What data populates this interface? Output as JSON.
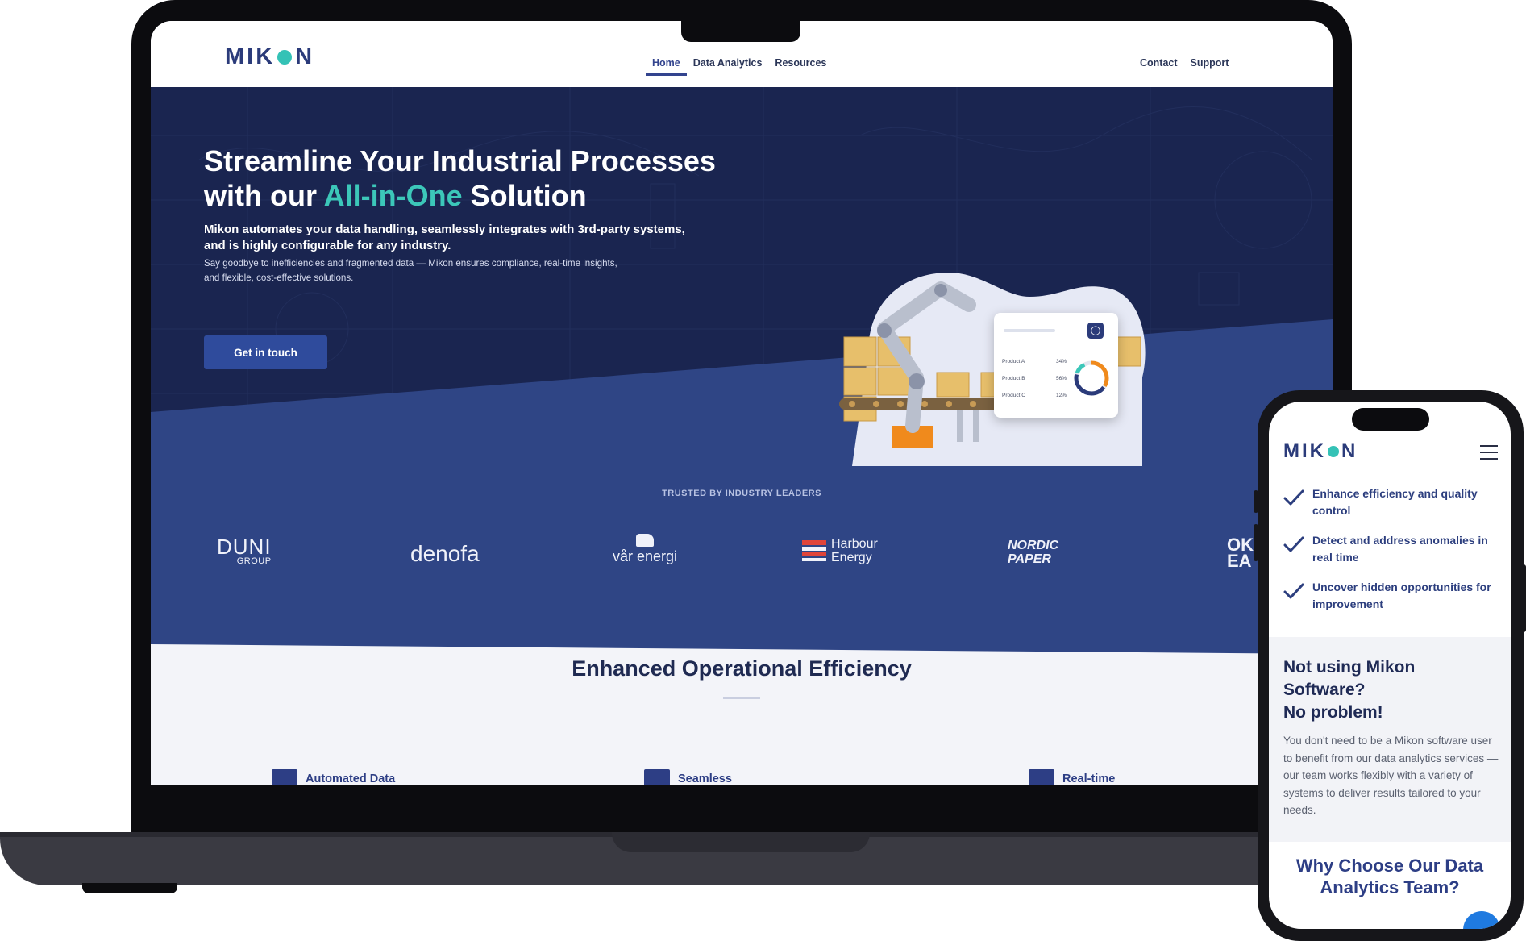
{
  "brand": {
    "name_start": "MIK",
    "name_end": "N",
    "accent": "#3cc7b9",
    "primary": "#2b3b7a"
  },
  "nav": {
    "links": [
      {
        "label": "Home",
        "active": true
      },
      {
        "label": "Data Analytics"
      },
      {
        "label": "Resources"
      }
    ],
    "right": [
      {
        "label": "Contact"
      },
      {
        "label": "Support"
      }
    ]
  },
  "hero": {
    "title_line1": "Streamline Your Industrial Processes",
    "title_line2_start": "with our ",
    "title_accent": "All-in-One",
    "title_line2_end": " Solution",
    "subtitle": "Mikon automates your data handling, seamlessly integrates with 3rd-party systems, and is highly configurable for any industry.",
    "description": "Say goodbye to inefficiencies and fragmented data — Mikon ensures compliance, real-time insights, and flexible, cost-effective solutions.",
    "cta": "Get in touch"
  },
  "dashboard_card": {
    "rows": [
      {
        "label": "Product A",
        "value": "34%"
      },
      {
        "label": "Product B",
        "value": "56%"
      },
      {
        "label": "Product C",
        "value": "12%"
      }
    ]
  },
  "trusted": {
    "heading": "TRUSTED BY INDUSTRY LEADERS",
    "logos": {
      "duni": "DUNI",
      "duni_sub": "GROUP",
      "denofa": "denofa",
      "varenergi": "vår energi",
      "harbour_1": "Harbour",
      "harbour_2": "Energy",
      "nordic_1": "NORDIC",
      "nordic_2": "PAPER",
      "okea_1": "OK",
      "okea_2": "EA"
    }
  },
  "efficiency": {
    "title": "Enhanced Operational Efficiency",
    "features": [
      "Automated Data",
      "Seamless",
      "Real-time"
    ]
  },
  "mobile": {
    "checks": [
      "Enhance efficiency and quality control",
      "Detect and address anomalies in real time",
      "Uncover hidden opportunities for improvement"
    ],
    "promo_heading_1": "Not using Mikon",
    "promo_heading_2": "Software?",
    "promo_heading_3": "No problem!",
    "promo_text": "You don't need to be a Mikon software user to benefit from our data analytics services — our team works flexibly with a variety of systems to deliver results tailored to your needs.",
    "why_heading": "Why Choose Our Data Analytics Team?"
  }
}
